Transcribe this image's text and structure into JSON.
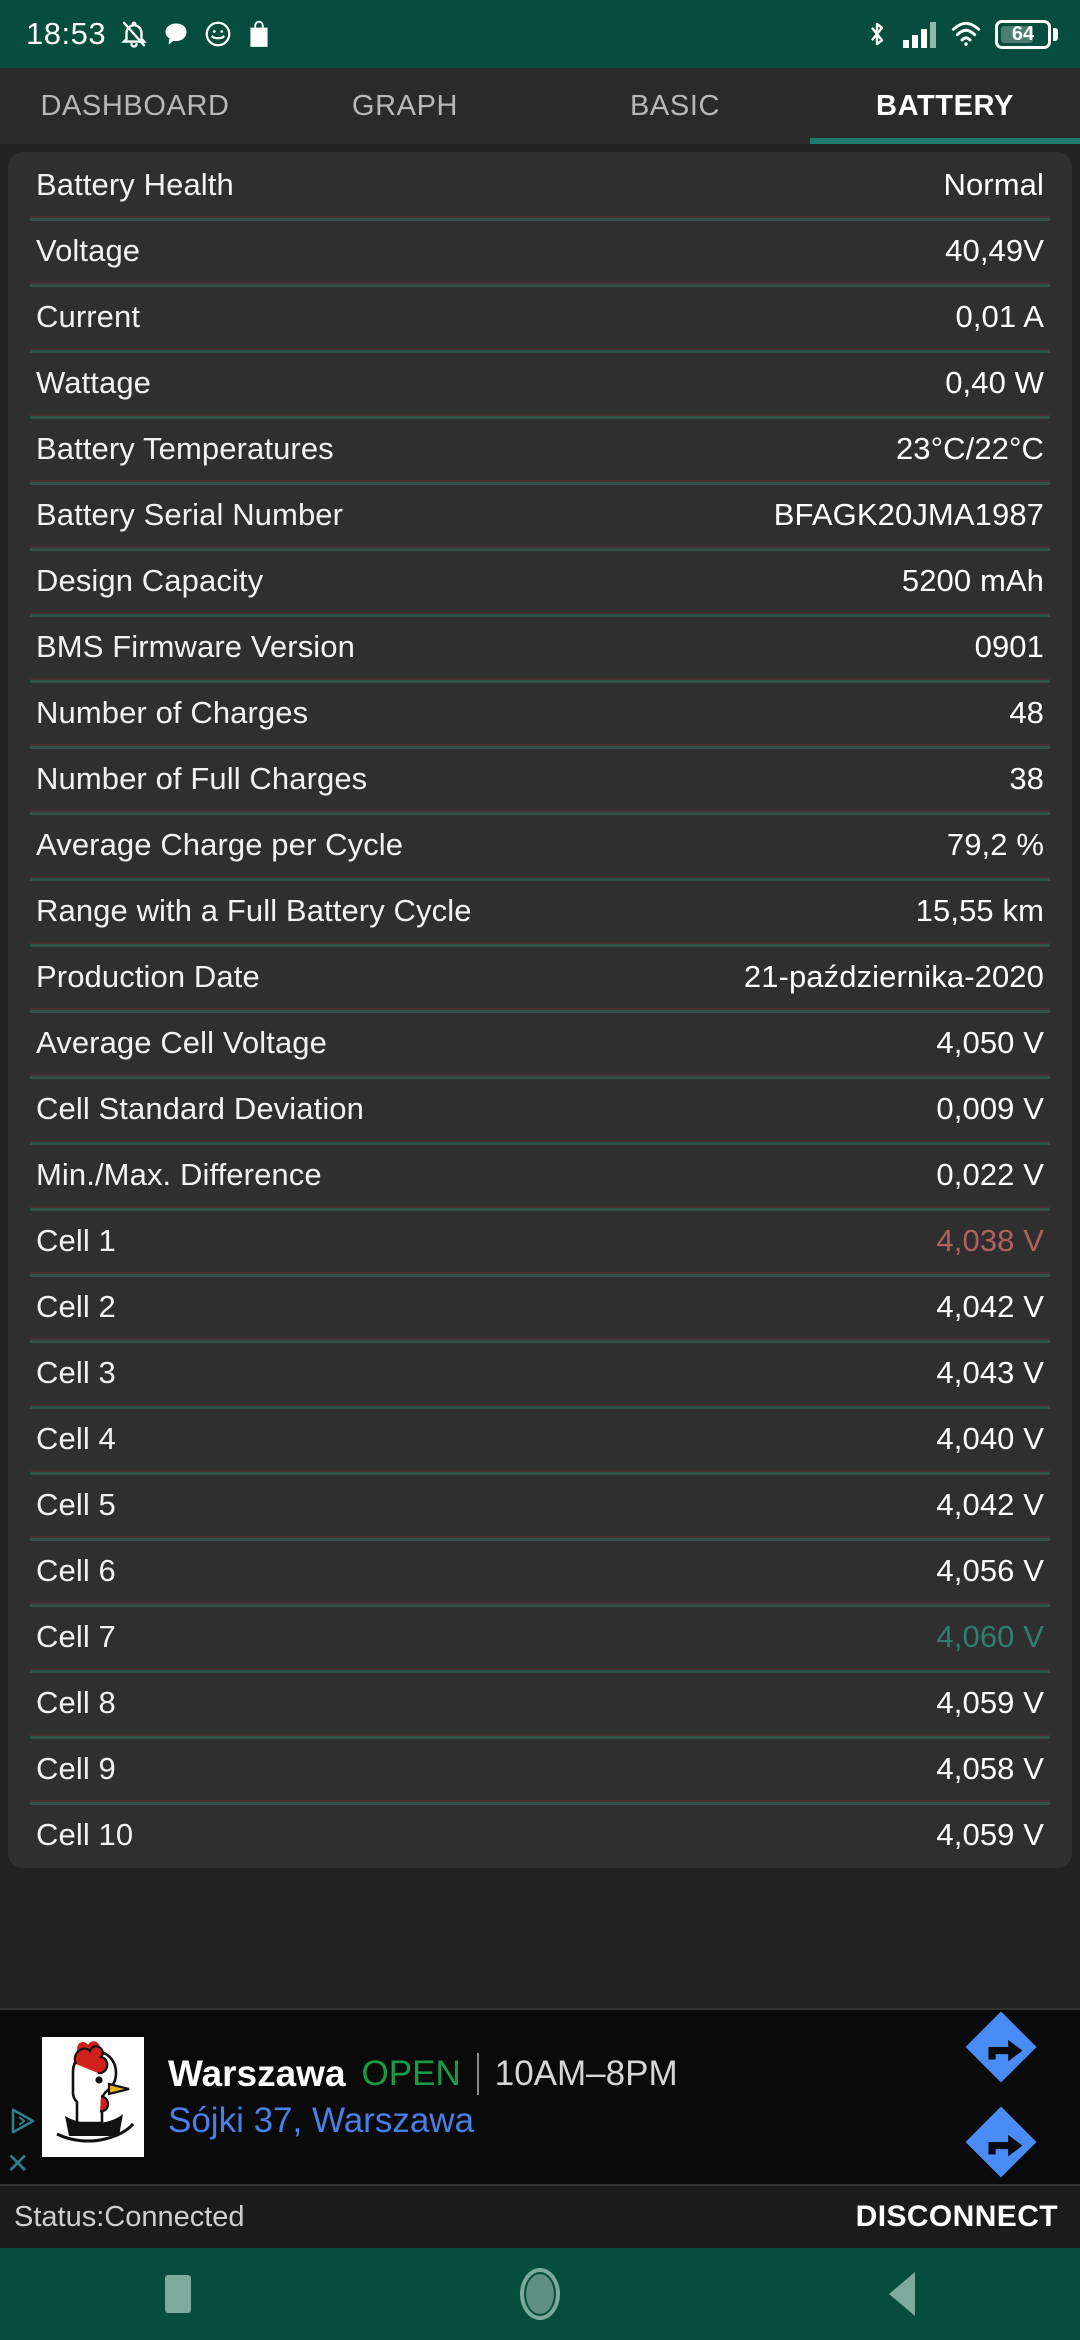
{
  "system_status_bar": {
    "clock": "18:53",
    "left_icons": [
      "bell-off-icon",
      "chat-bubble-icon",
      "smiley-face-icon",
      "shopping-bag-icon"
    ],
    "right_icons": [
      "bluetooth-icon",
      "signal-bars-icon",
      "wifi-icon"
    ],
    "battery_percent": "64",
    "background_color": "#064c3f"
  },
  "tabs": [
    {
      "label": "DASHBOARD",
      "active": false
    },
    {
      "label": "GRAPH",
      "active": false
    },
    {
      "label": "BASIC",
      "active": false
    },
    {
      "label": "BATTERY",
      "active": true
    }
  ],
  "accent_color": "#1d7a6e",
  "battery_rows": [
    {
      "label": "Battery Health",
      "value": "Normal",
      "state": "normal"
    },
    {
      "label": "Voltage",
      "value": "40,49V",
      "state": "normal"
    },
    {
      "label": "Current",
      "value": "0,01 A",
      "state": "normal"
    },
    {
      "label": "Wattage",
      "value": "0,40 W",
      "state": "normal"
    },
    {
      "label": "Battery Temperatures",
      "value": "23°C/22°C",
      "state": "normal"
    },
    {
      "label": "Battery Serial Number",
      "value": "BFAGK20JMA1987",
      "state": "normal"
    },
    {
      "label": "Design Capacity",
      "value": "5200 mAh",
      "state": "normal"
    },
    {
      "label": "BMS Firmware Version",
      "value": "0901",
      "state": "normal"
    },
    {
      "label": "Number of Charges",
      "value": "48",
      "state": "normal"
    },
    {
      "label": "Number of Full Charges",
      "value": "38",
      "state": "normal"
    },
    {
      "label": "Average Charge per Cycle",
      "value": "79,2 %",
      "state": "normal"
    },
    {
      "label": "Range with a Full Battery Cycle",
      "value": "15,55 km",
      "state": "normal"
    },
    {
      "label": "Production Date",
      "value": "21-października-2020",
      "state": "normal"
    },
    {
      "label": "Average Cell Voltage",
      "value": "4,050 V",
      "state": "normal"
    },
    {
      "label": "Cell Standard Deviation",
      "value": "0,009 V",
      "state": "normal"
    },
    {
      "label": "Min./Max. Difference",
      "value": "0,022 V",
      "state": "normal"
    },
    {
      "label": "Cell 1",
      "value": "4,038 V",
      "state": "low"
    },
    {
      "label": "Cell 2",
      "value": "4,042 V",
      "state": "normal"
    },
    {
      "label": "Cell 3",
      "value": "4,043 V",
      "state": "normal"
    },
    {
      "label": "Cell 4",
      "value": "4,040 V",
      "state": "normal"
    },
    {
      "label": "Cell 5",
      "value": "4,042 V",
      "state": "normal"
    },
    {
      "label": "Cell 6",
      "value": "4,056 V",
      "state": "normal"
    },
    {
      "label": "Cell 7",
      "value": "4,060 V",
      "state": "high"
    },
    {
      "label": "Cell 8",
      "value": "4,059 V",
      "state": "normal"
    },
    {
      "label": "Cell 9",
      "value": "4,058 V",
      "state": "normal"
    },
    {
      "label": "Cell 10",
      "value": "4,059 V",
      "state": "normal"
    }
  ],
  "cell_value_colors": {
    "low": "#b0615e",
    "high": "#2f7e6f",
    "normal": "#ffffff"
  },
  "ad": {
    "advertiser": "Warszawa",
    "open_label": "OPEN",
    "hours": "10AM–8PM",
    "address": "Sójki 37, Warszawa",
    "logo_icon": "rooster-logo-icon",
    "direction_icon": "turn-right-arrow-icon",
    "adchoices_icon": "adchoices-triangle-icon",
    "close_icon": "close-x-icon",
    "open_color": "#1a9a44",
    "address_color": "#4a7fe8",
    "arrow_color": "#4a8cf5"
  },
  "app_status": {
    "status_text": "Status:Connected",
    "disconnect_label": "DISCONNECT"
  },
  "nav_bar": {
    "items": [
      "recents-square-icon",
      "home-circle-icon",
      "back-triangle-icon"
    ],
    "background_color": "#064c3f"
  }
}
